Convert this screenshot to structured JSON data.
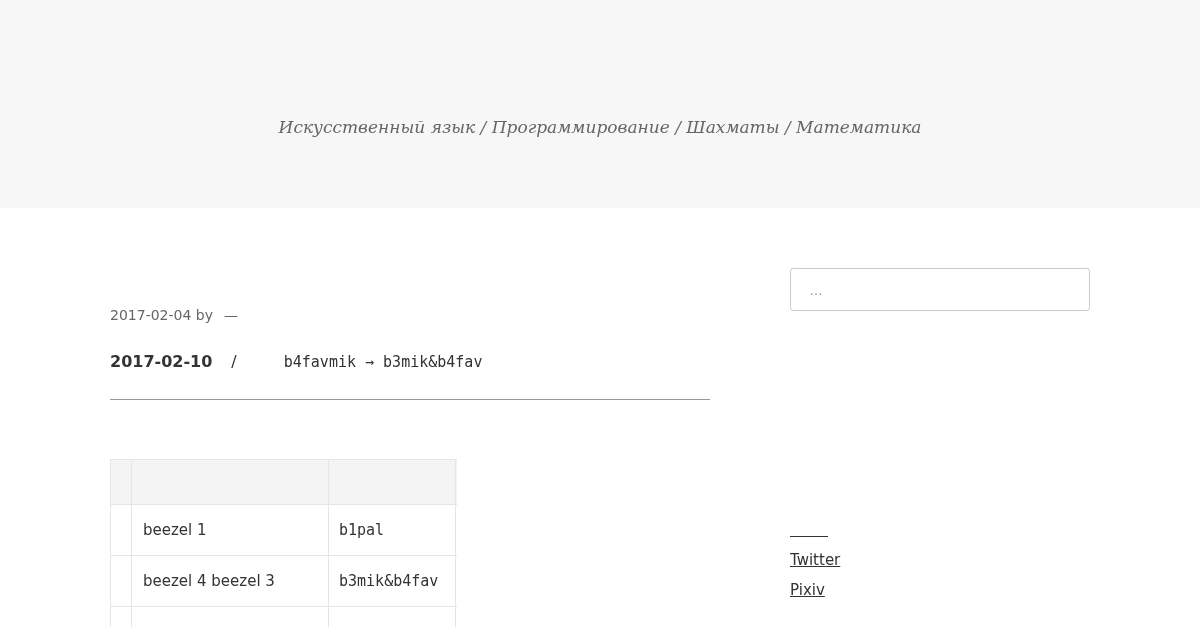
{
  "header": {
    "tagline": "Искусственный язык / Программирование / Шахматы / Математика"
  },
  "post": {
    "meta": "2017-02-04 by",
    "meta_dash": "—",
    "date": "2017-02-10",
    "separator": "/",
    "change": "b4favmik → b3mik&b4fav"
  },
  "table": {
    "rows": [
      {
        "name": "beezel 1",
        "code": "b1pal"
      },
      {
        "name": "beezel 4  beezel 3",
        "code": "b3mik&b4fav"
      }
    ]
  },
  "sidebar": {
    "search": {
      "placeholder": "…"
    },
    "links": [
      "Twitter",
      "Pixiv"
    ]
  }
}
